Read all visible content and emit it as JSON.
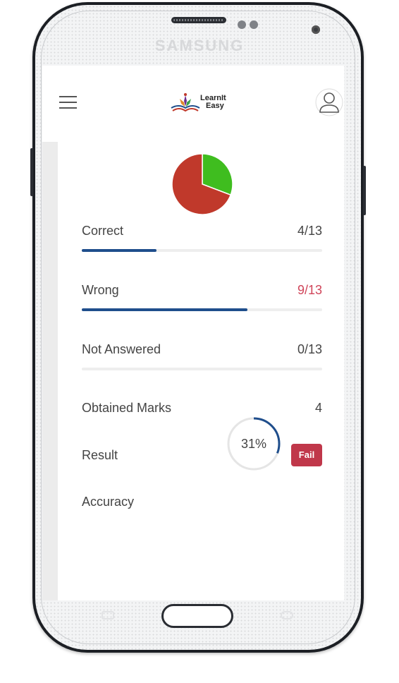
{
  "device": {
    "brand": "SAMSUNG"
  },
  "header": {
    "logo_line1": "LearnIt",
    "logo_line2": "Easy"
  },
  "chart_data": {
    "type": "pie",
    "categories": [
      "Correct",
      "Wrong"
    ],
    "values": [
      4,
      9
    ],
    "colors": [
      "#3fbd1f",
      "#c0392b"
    ]
  },
  "stats": {
    "correct": {
      "label": "Correct",
      "value": "4/13",
      "progress": 0.31
    },
    "wrong": {
      "label": "Wrong",
      "value": "9/13",
      "progress": 0.69
    },
    "not_answered": {
      "label": "Not Answered",
      "value": "0/13",
      "progress": 0
    },
    "obtained_marks": {
      "label": "Obtained Marks",
      "value": "4"
    },
    "result": {
      "label": "Result",
      "value": "Fail"
    },
    "accuracy": {
      "label": "Accuracy",
      "value": "31%",
      "progress": 0.31
    }
  },
  "colors": {
    "accent": "#1f4e8c",
    "wrong_text": "#d0455a",
    "fail_badge": "#c0374a"
  }
}
